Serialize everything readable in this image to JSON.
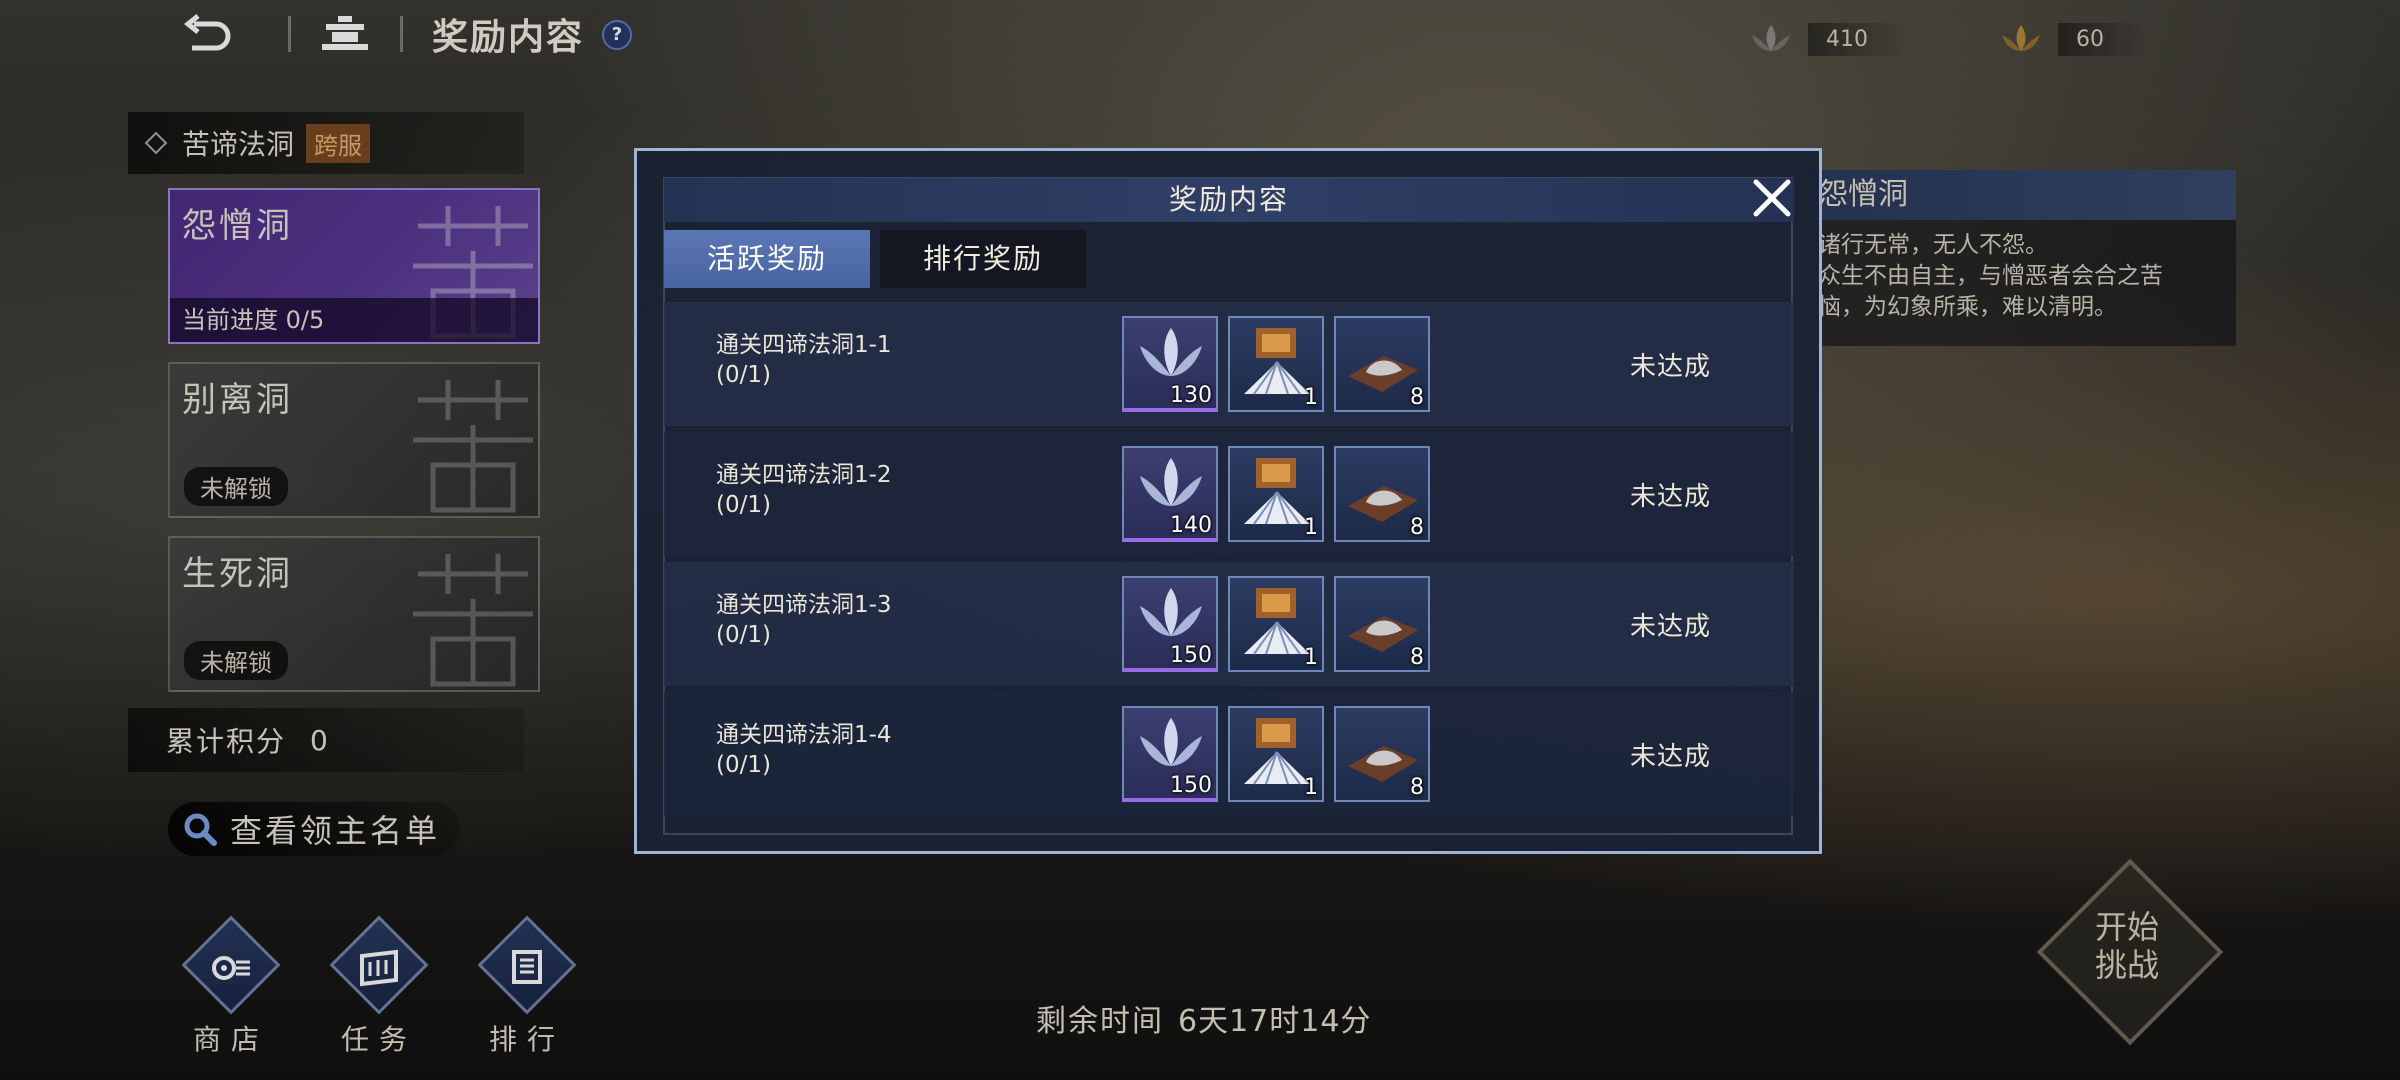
{
  "topbar": {
    "title": "奖励内容",
    "help": "?",
    "currency": [
      {
        "icon": "lotus-grey-icon",
        "value": "410"
      },
      {
        "icon": "lotus-gold-icon",
        "value": "60"
      }
    ]
  },
  "left_panel": {
    "zone_name": "苦谛法洞",
    "zone_badge": "跨服",
    "caves": [
      {
        "name": "怨憎洞",
        "progress": "当前进度 0/5",
        "state": "active"
      },
      {
        "name": "别离洞",
        "lock": "未解锁",
        "state": "locked"
      },
      {
        "name": "生死洞",
        "lock": "未解锁",
        "state": "locked"
      }
    ],
    "score_label": "累计积分",
    "score_value": "0",
    "lord_list": "查看领主名单"
  },
  "bottom_nav": [
    {
      "label": "商店",
      "icon": "shop-icon"
    },
    {
      "label": "任务",
      "icon": "quest-scroll-icon"
    },
    {
      "label": "排行",
      "icon": "ranking-icon"
    }
  ],
  "remaining": {
    "label": "剩余时间",
    "value": "6天17时14分"
  },
  "start": {
    "line1": "开始",
    "line2": "挑战"
  },
  "right_info": {
    "title": "怨憎洞",
    "lines": [
      "诸行无常，无人不怨。",
      "众生不由自主，与憎恶者会合之苦",
      "恼，为幻象所乘，难以清明。"
    ]
  },
  "modal": {
    "title": "奖励内容",
    "tabs": [
      {
        "label": "活跃奖励",
        "active": true
      },
      {
        "label": "排行奖励",
        "active": false
      }
    ],
    "rows": [
      {
        "name": "通关四谛法洞1-1",
        "progress": "(0/1)",
        "items": [
          {
            "icon": "lotus-icon",
            "count": "130"
          },
          {
            "icon": "fan-chest-icon",
            "count": "1"
          },
          {
            "icon": "ore-pile-icon",
            "count": "8"
          }
        ],
        "status": "未达成"
      },
      {
        "name": "通关四谛法洞1-2",
        "progress": "(0/1)",
        "items": [
          {
            "icon": "lotus-icon",
            "count": "140"
          },
          {
            "icon": "fan-chest-icon",
            "count": "1"
          },
          {
            "icon": "ore-pile-icon",
            "count": "8"
          }
        ],
        "status": "未达成"
      },
      {
        "name": "通关四谛法洞1-3",
        "progress": "(0/1)",
        "items": [
          {
            "icon": "lotus-icon",
            "count": "150"
          },
          {
            "icon": "fan-chest-icon",
            "count": "1"
          },
          {
            "icon": "ore-pile-icon",
            "count": "8"
          }
        ],
        "status": "未达成"
      },
      {
        "name": "通关四谛法洞1-4",
        "progress": "(0/1)",
        "items": [
          {
            "icon": "lotus-icon",
            "count": "150"
          },
          {
            "icon": "fan-chest-icon",
            "count": "1"
          },
          {
            "icon": "ore-pile-icon",
            "count": "8"
          }
        ],
        "status": "未达成"
      }
    ]
  }
}
